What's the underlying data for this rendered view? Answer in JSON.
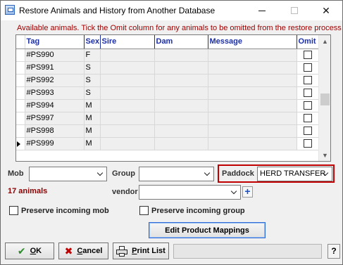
{
  "window": {
    "title": "Restore Animals and History from Another Database"
  },
  "info": "Available animals. Tick the Omit column for any animals to be omitted from the restore process",
  "grid": {
    "columns": [
      "Tag",
      "Sex",
      "Sire",
      "Dam",
      "Message",
      "Omit"
    ],
    "rows": [
      {
        "tag": "#PS990",
        "sex": "F",
        "sire": "",
        "dam": "",
        "message": "",
        "omit": false,
        "current": false
      },
      {
        "tag": "#PS991",
        "sex": "S",
        "sire": "",
        "dam": "",
        "message": "",
        "omit": false,
        "current": false
      },
      {
        "tag": "#PS992",
        "sex": "S",
        "sire": "",
        "dam": "",
        "message": "",
        "omit": false,
        "current": false
      },
      {
        "tag": "#PS993",
        "sex": "S",
        "sire": "",
        "dam": "",
        "message": "",
        "omit": false,
        "current": false
      },
      {
        "tag": "#PS994",
        "sex": "M",
        "sire": "",
        "dam": "",
        "message": "",
        "omit": false,
        "current": false
      },
      {
        "tag": "#PS997",
        "sex": "M",
        "sire": "",
        "dam": "",
        "message": "",
        "omit": false,
        "current": false
      },
      {
        "tag": "#PS998",
        "sex": "M",
        "sire": "",
        "dam": "",
        "message": "",
        "omit": false,
        "current": false
      },
      {
        "tag": "#PS999",
        "sex": "M",
        "sire": "",
        "dam": "",
        "message": "",
        "omit": false,
        "current": true
      }
    ]
  },
  "form": {
    "mob_label": "Mob",
    "mob_value": "",
    "group_label": "Group",
    "group_value": "",
    "paddock_label": "Paddock",
    "paddock_value": "HERD TRANSFER",
    "vendor_label": "vendor",
    "vendor_value": "",
    "animal_count": "17 animals",
    "plus_label": "+",
    "preserve_mob_label": "Preserve incoming mob",
    "preserve_mob_checked": false,
    "preserve_group_label": "Preserve incoming  group",
    "preserve_group_checked": false,
    "edit_mappings_label": "Edit Product Mappings"
  },
  "buttons": {
    "ok_first": "O",
    "ok_rest": "K",
    "cancel_first": "C",
    "cancel_rest": "ancel",
    "print_first": "P",
    "print_rest": "rint List",
    "help": "?"
  },
  "colors": {
    "info_text": "#a00000",
    "header_text": "#1c2fa6",
    "count_text": "#8b0000",
    "paddock_highlight": "#c00000"
  }
}
